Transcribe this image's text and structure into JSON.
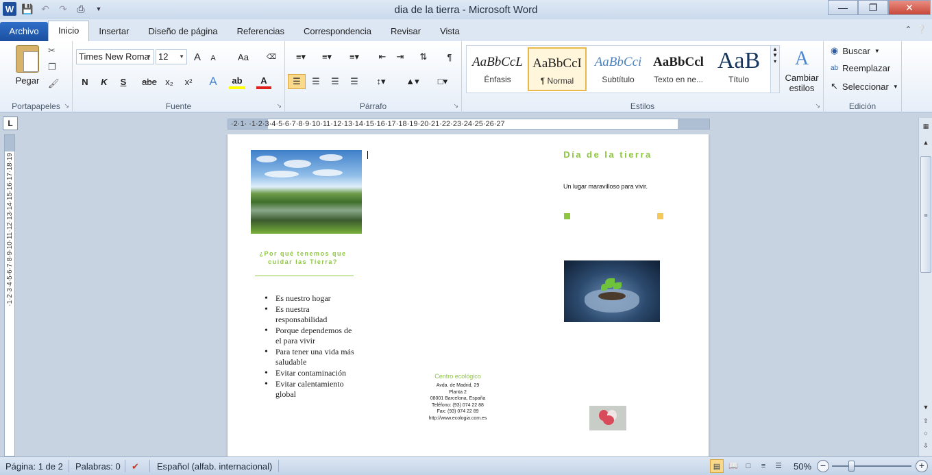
{
  "window": {
    "title": "dia de la tierra - Microsoft Word",
    "app_icon_letter": "W"
  },
  "tabs": [
    {
      "label": "Archivo"
    },
    {
      "label": "Inicio"
    },
    {
      "label": "Insertar"
    },
    {
      "label": "Diseño de página"
    },
    {
      "label": "Referencias"
    },
    {
      "label": "Correspondencia"
    },
    {
      "label": "Revisar"
    },
    {
      "label": "Vista"
    }
  ],
  "ribbon": {
    "clipboard": {
      "paste_label": "Pegar",
      "group_label": "Portapapeles"
    },
    "font": {
      "name": "Times New Roma",
      "size": "12",
      "group_label": "Fuente",
      "bold": "N",
      "italic": "K",
      "underline": "S",
      "strike": "abe",
      "sub": "x₂",
      "sup": "x²",
      "case": "Aa",
      "grow": "A",
      "shrink": "A",
      "highlight": "ab",
      "font_color": "A",
      "highlight_color": "#ffff00",
      "font_color_value": "#e0201b"
    },
    "paragraph": {
      "group_label": "Párrafo"
    },
    "styles": {
      "group_label": "Estilos",
      "items": [
        {
          "sample": "AaBbCcL",
          "name": "Énfasis"
        },
        {
          "sample": "AaBbCcI",
          "name": "¶ Normal"
        },
        {
          "sample": "AaBbCci",
          "name": "Subtítulo"
        },
        {
          "sample": "AaBbCcl",
          "name": "Texto en ne..."
        },
        {
          "sample": "AaB",
          "name": "Título"
        }
      ],
      "change_label": "Cambiar estilos"
    },
    "editing": {
      "group_label": "Edición",
      "find": "Buscar",
      "replace": "Reemplazar",
      "select": "Seleccionar"
    }
  },
  "ruler": {
    "horizontal": "·2·1·  ·1·2·3·4·5·6·7·8·9·10·11·12·13·14·15·16·17·18·19·20·21·22·23·24·25·26·27",
    "vertical": "·1·2·3·4·5·6·7·8·9·10·11·12·13·14·15·16·17·18·19"
  },
  "document": {
    "left_panel": {
      "heading": "¿Por qué tenemos que cuidar las Tierra?",
      "bullets": [
        "Es nuestro hogar",
        "Es nuestra responsabilidad",
        "Porque dependemos de el para vivir",
        "Para tener una vida más saludable",
        "Evitar contaminación",
        "Evitar calentamiento global"
      ]
    },
    "middle_panel": {
      "org_name": "Centro ecológico",
      "address": [
        "Avda. de Madrid, 29",
        "Planta 2",
        "08001 Barcelona, España",
        "Teléfono: (93) 074 22 88",
        "Fax: (93) 074 22 89",
        "http://www.ecologia.com.es"
      ]
    },
    "right_panel": {
      "title": "Día de la tierra",
      "tagline": "Un lugar maravilloso para vivir."
    },
    "colors": {
      "accent_green": "#8dc63f",
      "accent_yellow": "#f5c85a"
    }
  },
  "status": {
    "page": "Página: 1 de 2",
    "words": "Palabras: 0",
    "language": "Español (alfab. internacional)",
    "zoom": "50%",
    "zoom_percent": 50
  }
}
